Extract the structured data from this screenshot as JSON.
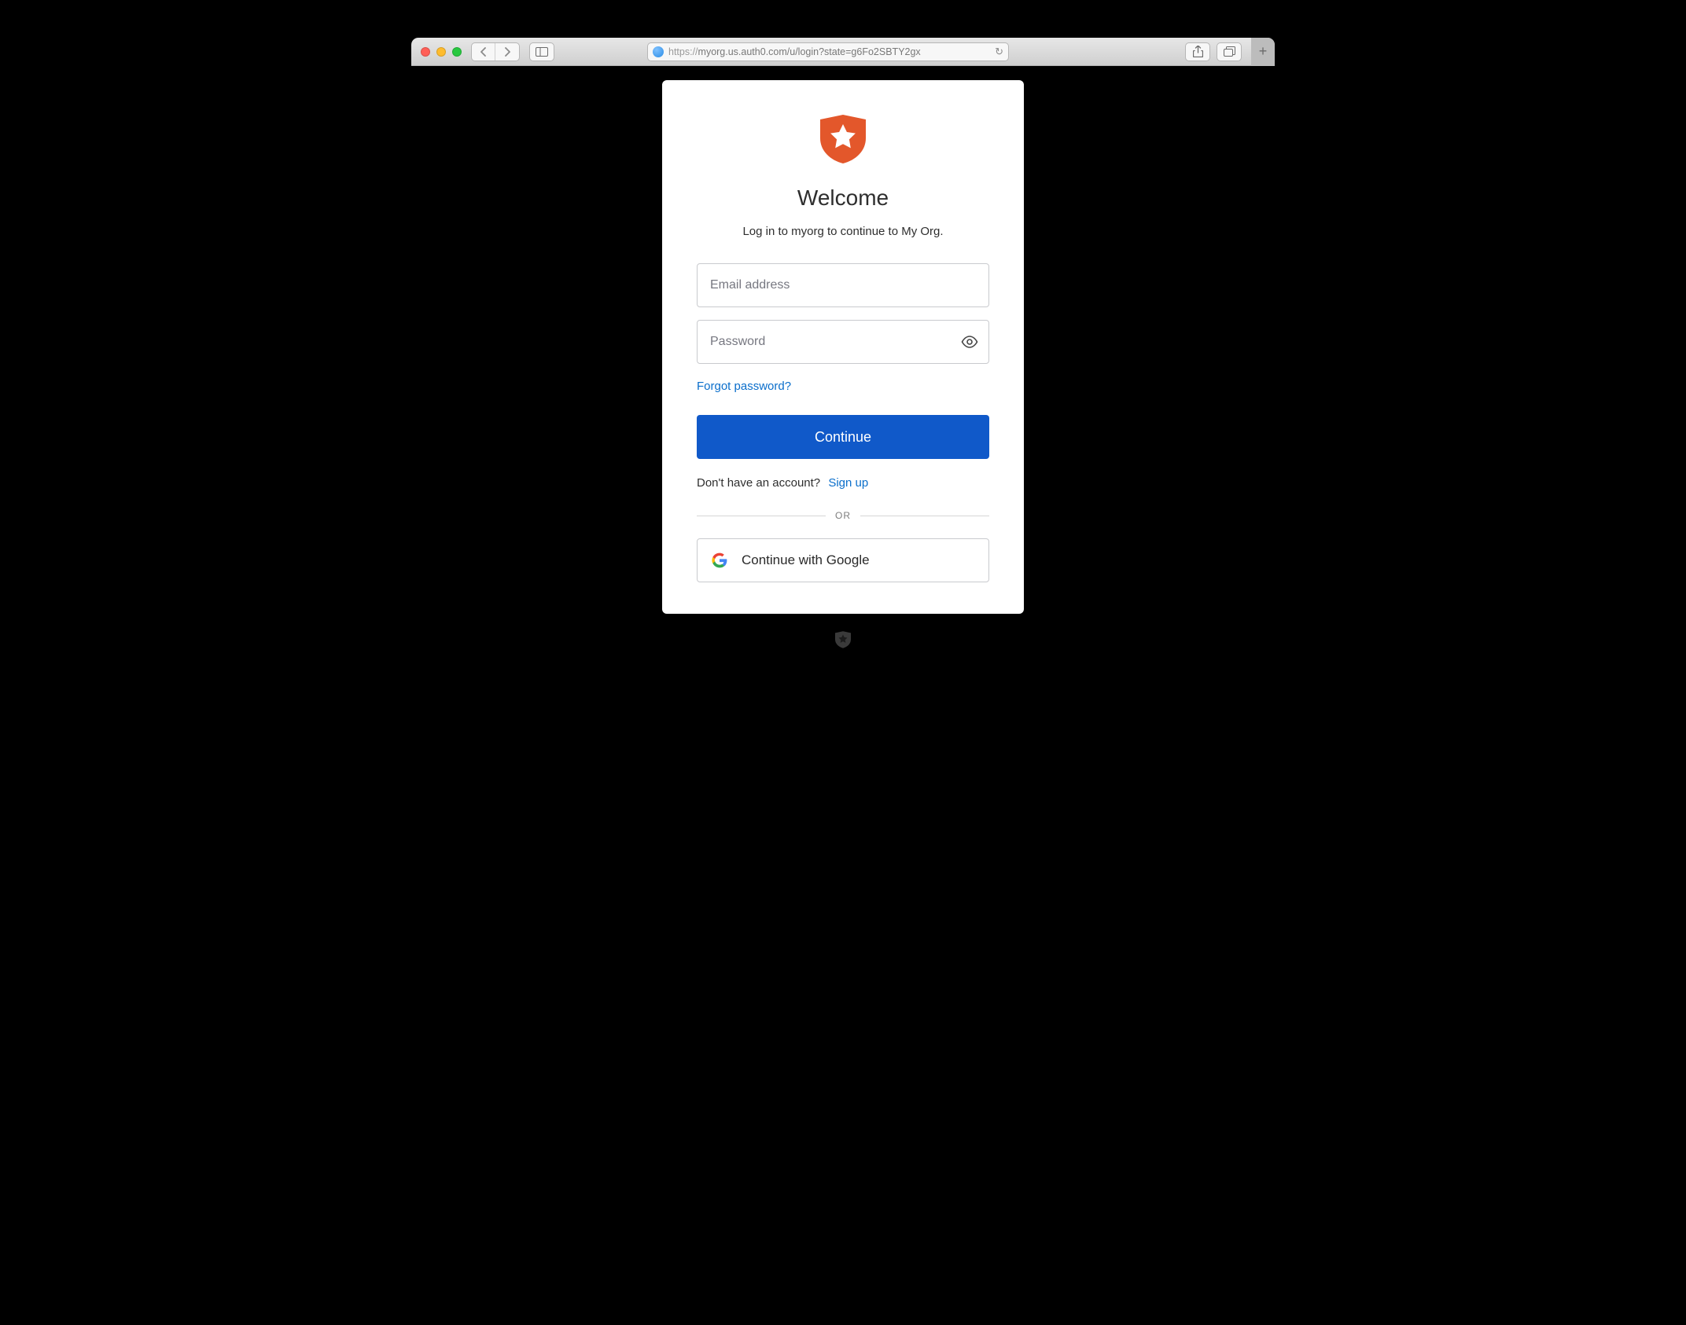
{
  "browser": {
    "url_protocol": "https://",
    "url_rest": "myorg.us.auth0.com/u/login?state=g6Fo2SBTY2gx"
  },
  "login": {
    "title": "Welcome",
    "subtitle": "Log in to myorg to continue to My Org.",
    "email_placeholder": "Email address",
    "password_placeholder": "Password",
    "forgot": "Forgot password?",
    "continue": "Continue",
    "signup_prompt": "Don't have an account?",
    "signup_link": "Sign up",
    "or": "OR",
    "google": "Continue with Google"
  },
  "colors": {
    "primary": "#1059c9",
    "link": "#0a6ecb",
    "brand_orange": "#e3572b"
  }
}
